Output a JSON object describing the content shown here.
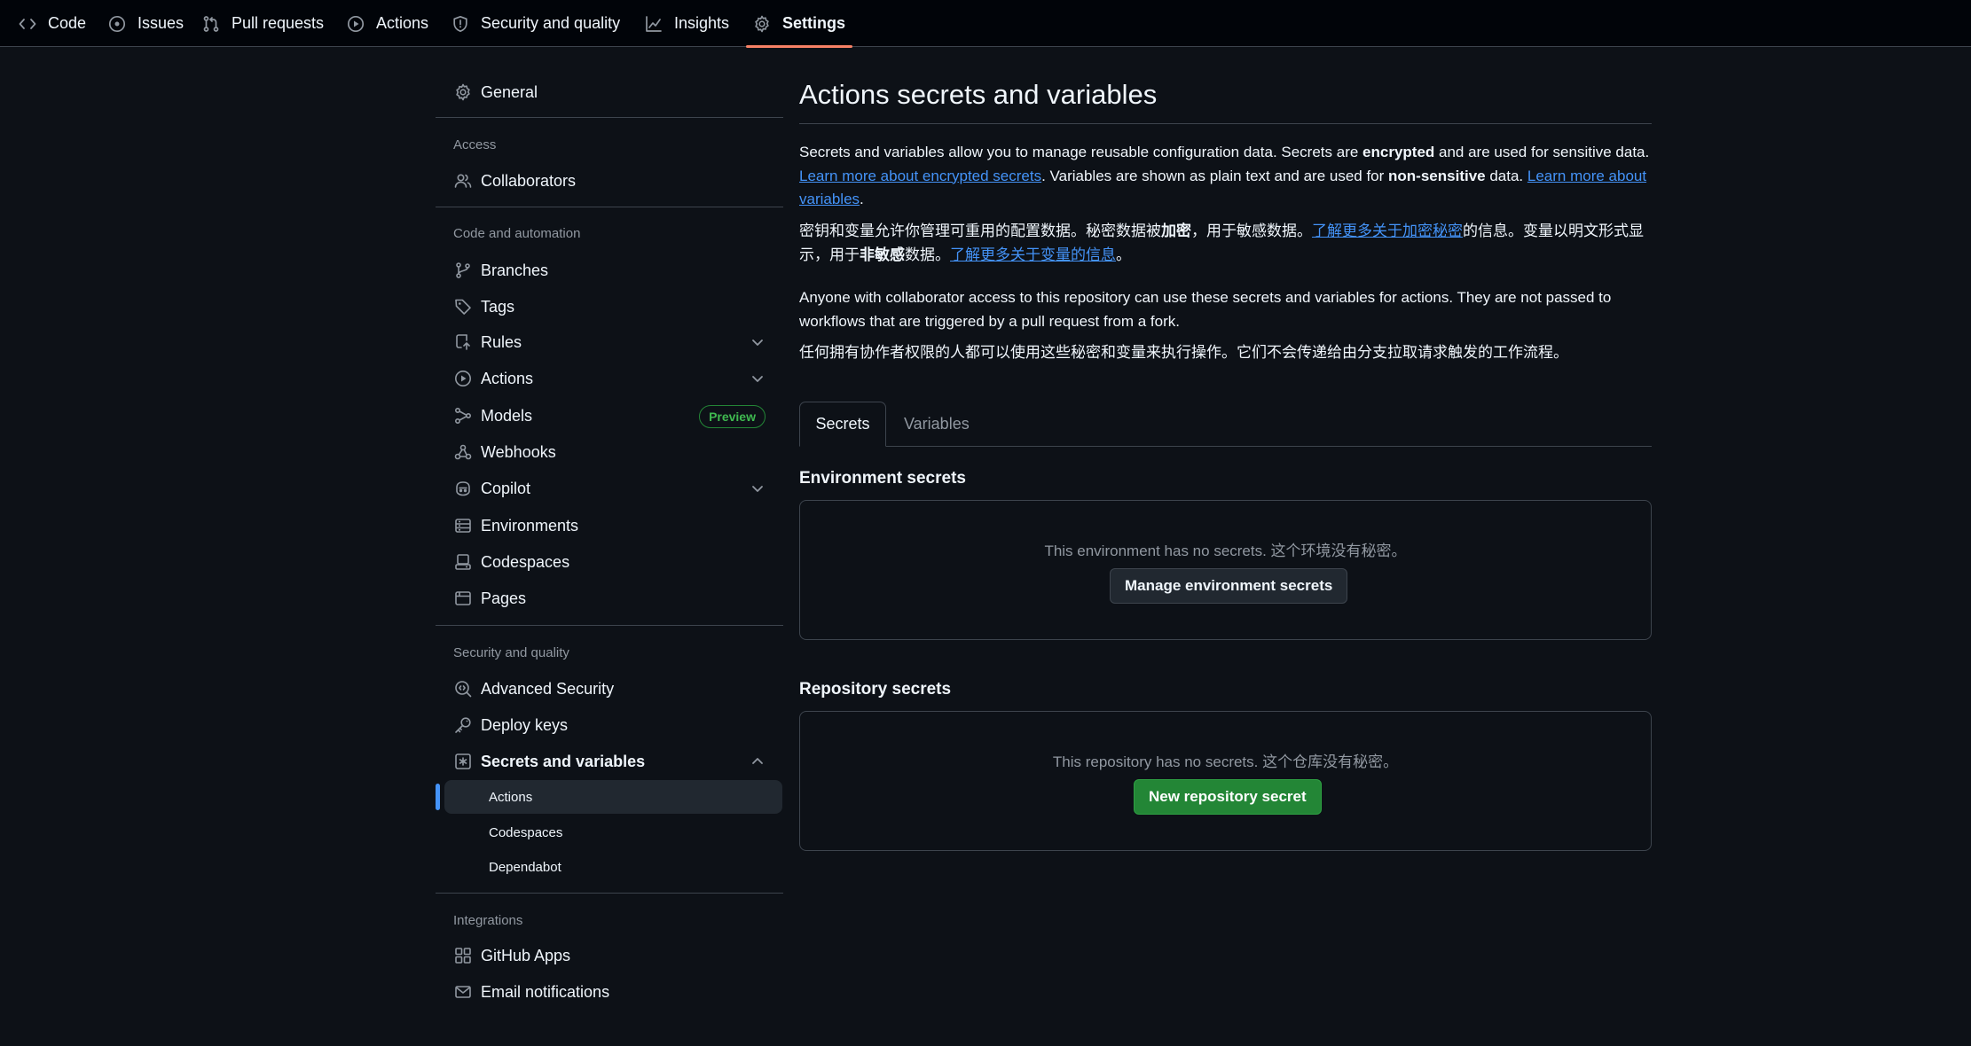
{
  "topnav": {
    "tabs": [
      {
        "label": "Code",
        "icon": "code-icon"
      },
      {
        "label": "Issues",
        "icon": "issue-opened-icon"
      },
      {
        "label": "Pull requests",
        "icon": "pull-request-icon"
      },
      {
        "label": "Actions",
        "icon": "play-icon"
      },
      {
        "label": "Security and quality",
        "icon": "shield-icon"
      },
      {
        "label": "Insights",
        "icon": "graph-icon"
      },
      {
        "label": "Settings",
        "icon": "gear-icon",
        "selected": true
      }
    ]
  },
  "sidebar": {
    "general": "General",
    "access_heading": "Access",
    "collaborators": "Collaborators",
    "code_heading": "Code and automation",
    "branches": "Branches",
    "tags": "Tags",
    "rules": "Rules",
    "actions": "Actions",
    "models": "Models",
    "models_badge": "Preview",
    "webhooks": "Webhooks",
    "copilot": "Copilot",
    "environments": "Environments",
    "codespaces": "Codespaces",
    "pages": "Pages",
    "security_heading": "Security and quality",
    "advanced_security": "Advanced Security",
    "deploy_keys": "Deploy keys",
    "secrets_and_variables": "Secrets and variables",
    "sub_actions": "Actions",
    "sub_codespaces": "Codespaces",
    "sub_dependabot": "Dependabot",
    "integrations_heading": "Integrations",
    "github_apps": "GitHub Apps",
    "email_notifications": "Email notifications"
  },
  "main": {
    "title": "Actions secrets and variables",
    "intro": {
      "t1": "Secrets and variables allow you to manage reusable configuration data. Secrets are ",
      "b1": "encrypted",
      "t2": " and are used for sensitive data. ",
      "link1": "Learn more about encrypted secrets",
      "t3": ". Variables are shown as plain text and are used for ",
      "b2": "non-sensitive",
      "t4": " data. ",
      "link2": "Learn more about variables",
      "t5": "."
    },
    "intro_cn": {
      "t1": "密钥和变量允许你管理可重用的配置数据。秘密数据被",
      "b1": "加密",
      "t2": "，用于敏感数据。",
      "link1": "了解更多关于加密秘密",
      "t3": "的信息。变量以明文形式显示，用于",
      "b2": "非敏感",
      "t4": "数据。",
      "link2": "了解更多关于变量的信息",
      "t5": "。"
    },
    "access_note": "Anyone with collaborator access to this repository can use these secrets and variables for actions. They are not passed to workflows that are triggered by a pull request from a fork.",
    "access_note_cn": "任何拥有协作者权限的人都可以使用这些秘密和变量来执行操作。它们不会传递给由分支拉取请求触发的工作流程。",
    "tabs": {
      "secrets": "Secrets",
      "variables": "Variables"
    },
    "env_secrets": {
      "heading": "Environment secrets",
      "empty": "This environment has no secrets.  这个环境没有秘密。",
      "button": "Manage environment secrets"
    },
    "repo_secrets": {
      "heading": "Repository secrets",
      "empty": "This repository has no secrets.  这个仓库没有秘密。",
      "button": "New repository secret"
    }
  },
  "colors": {
    "background": "#0d1117",
    "header": "#010409",
    "border": "#3d444d",
    "accent_link": "#4493f8",
    "selected_tab_underline": "#f78166",
    "primary_button": "#238636",
    "preview_badge": "#3fb950"
  }
}
